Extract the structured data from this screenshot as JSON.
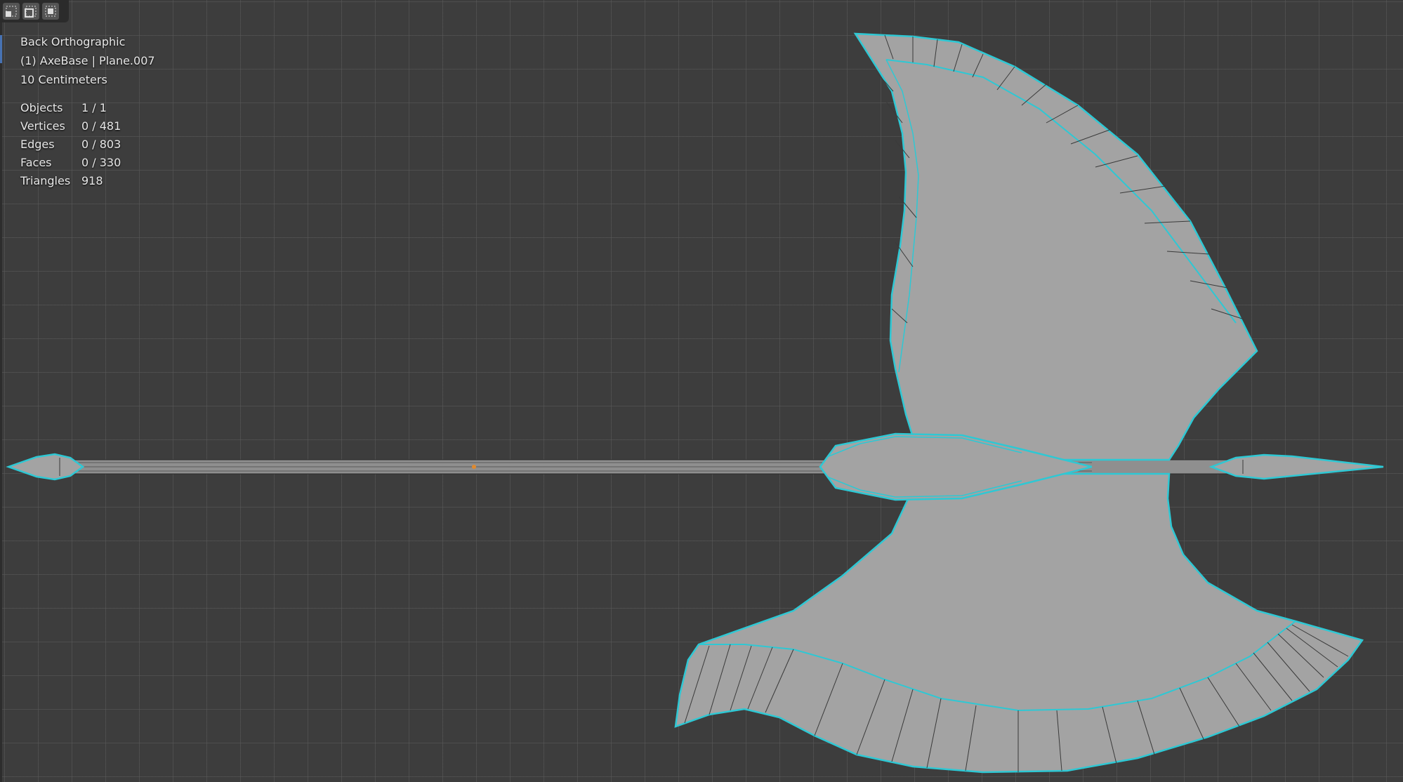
{
  "viewport": {
    "view_name": "Back Orthographic",
    "object_info": "(1) AxeBase | Plane.007",
    "scale": "10 Centimeters"
  },
  "stats": [
    {
      "label": "Objects",
      "value": "1 / 1"
    },
    {
      "label": "Vertices",
      "value": "0 / 481"
    },
    {
      "label": "Edges",
      "value": "0 / 803"
    },
    {
      "label": "Faces",
      "value": "0 / 330"
    },
    {
      "label": "Triangles",
      "value": "918"
    }
  ],
  "colors": {
    "background": "#3d3d3d",
    "face": "#a3a3a3",
    "outline": "#2ec8d4",
    "origin": "#e08a2e"
  },
  "toolbar": {
    "icons": [
      "vertex-select-icon",
      "edge-select-icon",
      "face-select-icon"
    ]
  }
}
